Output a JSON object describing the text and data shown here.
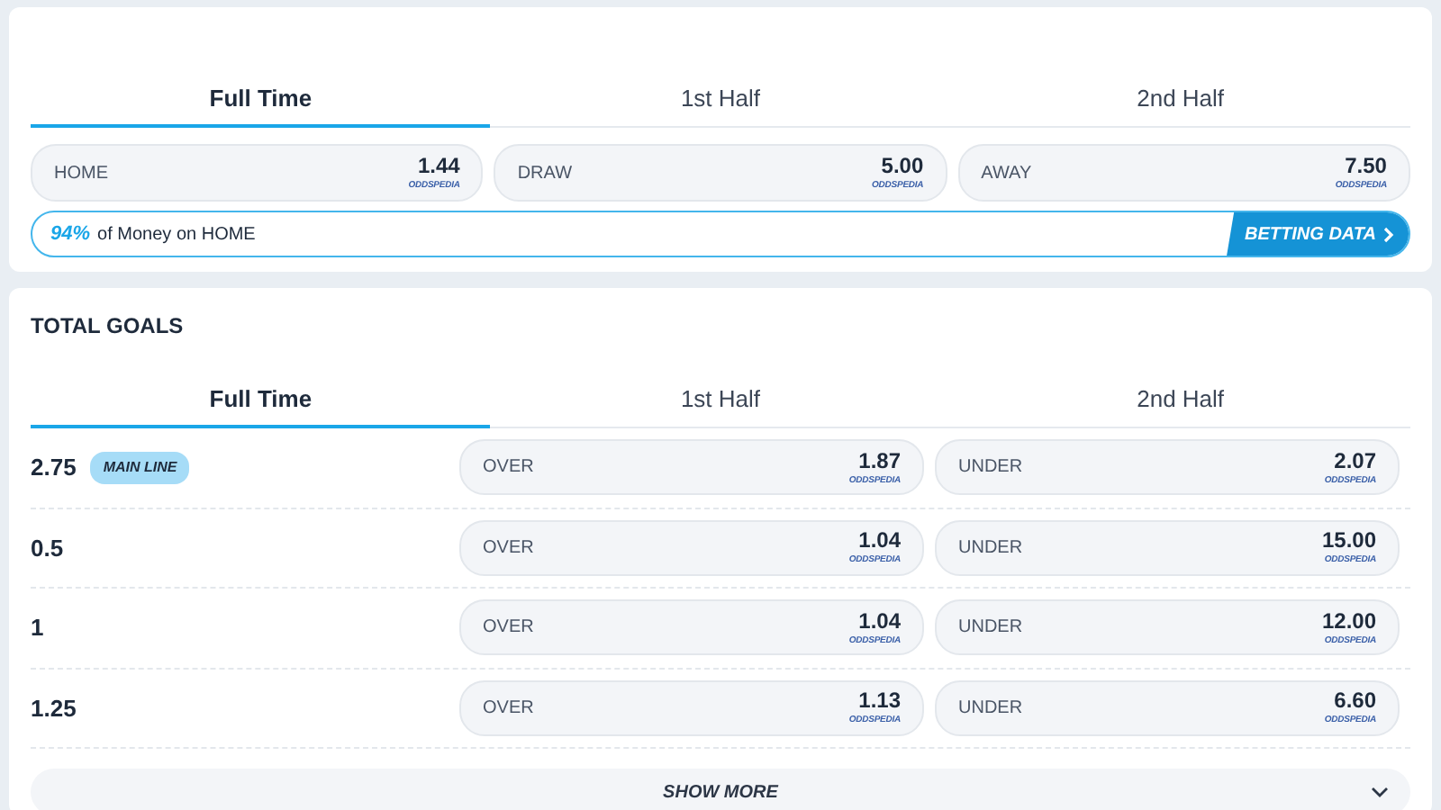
{
  "match_result": {
    "tabs": [
      {
        "label": "Full Time",
        "selected": true
      },
      {
        "label": "1st Half",
        "selected": false
      },
      {
        "label": "2nd Half",
        "selected": false
      }
    ],
    "odds": [
      {
        "label": "HOME",
        "value": "1.44",
        "source": "ODDSPEDIA"
      },
      {
        "label": "DRAW",
        "value": "5.00",
        "source": "ODDSPEDIA"
      },
      {
        "label": "AWAY",
        "value": "7.50",
        "source": "ODDSPEDIA"
      }
    ],
    "money_bar": {
      "percent": "94%",
      "text": "of Money on HOME",
      "button": "BETTING DATA"
    }
  },
  "total_goals": {
    "title": "TOTAL GOALS",
    "tabs": [
      {
        "label": "Full Time",
        "selected": true
      },
      {
        "label": "1st Half",
        "selected": false
      },
      {
        "label": "2nd Half",
        "selected": false
      }
    ],
    "rows": [
      {
        "line": "2.75",
        "badge": "MAIN LINE",
        "over": {
          "label": "OVER",
          "value": "1.87",
          "source": "ODDSPEDIA"
        },
        "under": {
          "label": "UNDER",
          "value": "2.07",
          "source": "ODDSPEDIA"
        }
      },
      {
        "line": "0.5",
        "over": {
          "label": "OVER",
          "value": "1.04",
          "source": "ODDSPEDIA"
        },
        "under": {
          "label": "UNDER",
          "value": "15.00",
          "source": "ODDSPEDIA"
        }
      },
      {
        "line": "1",
        "over": {
          "label": "OVER",
          "value": "1.04",
          "source": "ODDSPEDIA"
        },
        "under": {
          "label": "UNDER",
          "value": "12.00",
          "source": "ODDSPEDIA"
        }
      },
      {
        "line": "1.25",
        "over": {
          "label": "OVER",
          "value": "1.13",
          "source": "ODDSPEDIA"
        },
        "under": {
          "label": "UNDER",
          "value": "6.60",
          "source": "ODDSPEDIA"
        }
      }
    ],
    "show_more": "SHOW MORE"
  }
}
